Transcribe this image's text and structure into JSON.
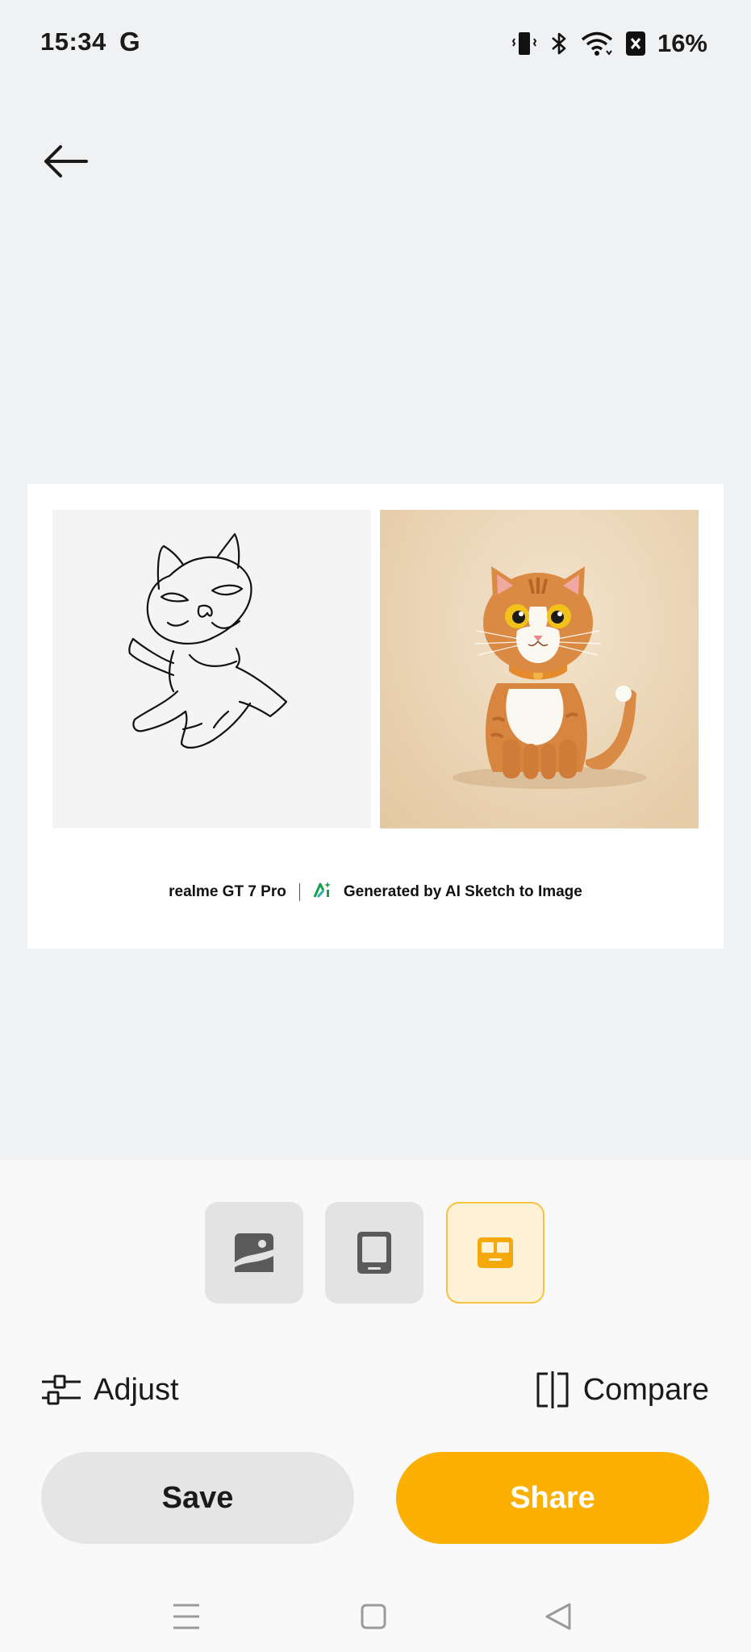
{
  "status_bar": {
    "time": "15:34",
    "g_label": "G",
    "battery": "16%",
    "icons": [
      "vibrate-icon",
      "bluetooth-icon",
      "wifi-icon",
      "battery-saver-icon"
    ]
  },
  "header": {
    "back_icon": "arrow-left-icon"
  },
  "preview": {
    "brand": "realme GT 7 Pro",
    "generated_label": "Generated by AI Sketch to Image",
    "ai_icon": "ai-sparkle-icon",
    "left_image": "cat-sketch",
    "right_image": "cat-3d-render"
  },
  "layout_options": [
    {
      "icon": "image-layout-icon",
      "selected": false
    },
    {
      "icon": "frame-layout-icon",
      "selected": false
    },
    {
      "icon": "side-by-side-layout-icon",
      "selected": true
    }
  ],
  "tools": {
    "adjust_label": "Adjust",
    "compare_label": "Compare"
  },
  "actions": {
    "save_label": "Save",
    "share_label": "Share"
  },
  "colors": {
    "accent": "#fbb003",
    "background": "#f0f1f3",
    "sheet": "#f9f9f9"
  },
  "navbar": [
    "menu-icon",
    "home-icon",
    "back-triangle-icon"
  ]
}
